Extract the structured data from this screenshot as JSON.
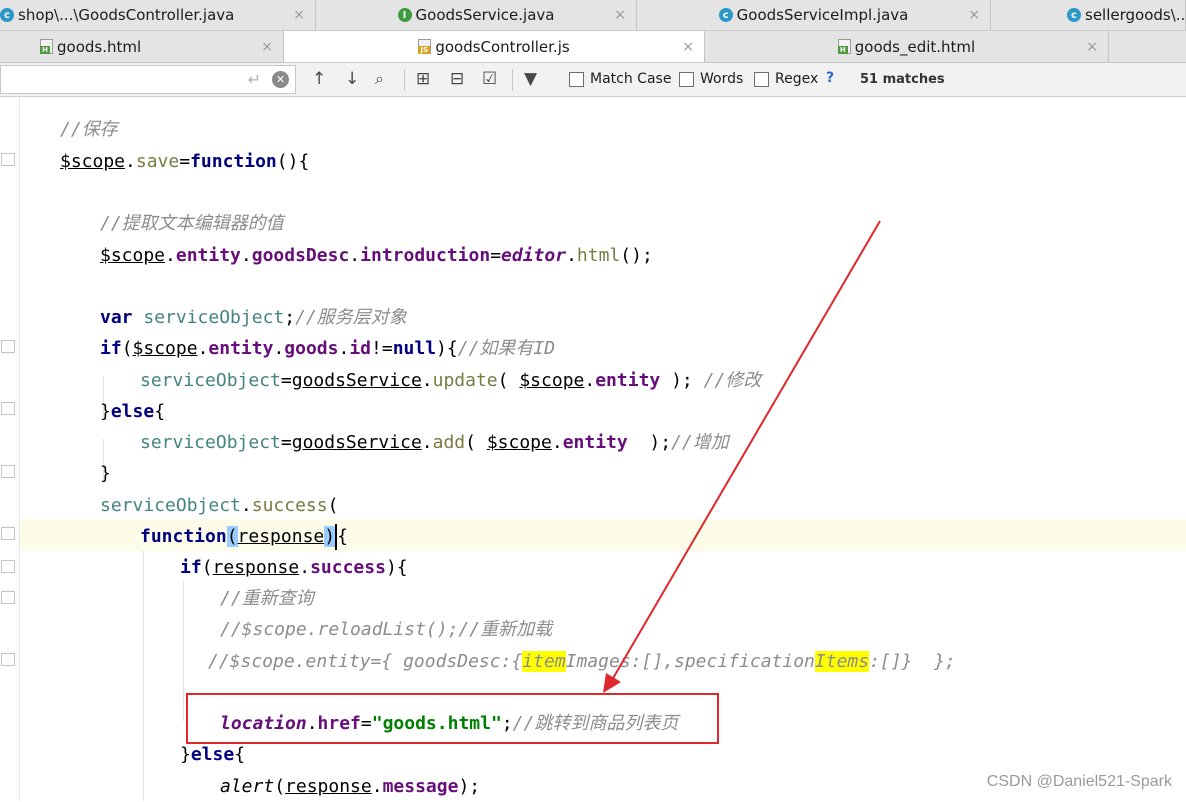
{
  "tabs_row1": [
    {
      "label": "shop\\...\\GoodsController.java",
      "icon": "java-class-icon"
    },
    {
      "label": "GoodsService.java",
      "icon": "java-interface-icon"
    },
    {
      "label": "GoodsServiceImpl.java",
      "icon": "java-class-icon"
    },
    {
      "label": "sellergoods\\...",
      "icon": "java-class-icon"
    }
  ],
  "tabs_row2": [
    {
      "label": "goods.html",
      "icon": "html-file-icon"
    },
    {
      "label": "goodsController.js",
      "icon": "js-file-icon",
      "active": true
    },
    {
      "label": "goods_edit.html",
      "icon": "html-file-icon"
    }
  ],
  "close_glyph": "×",
  "search": {
    "value": "",
    "match_case": "Match Case",
    "words": "Words",
    "regex": "Regex",
    "help": "?",
    "matches": "51 matches"
  },
  "code": [
    "//保存",
    "$scope.save=function(){",
    "//提取文本编辑器的值",
    "$scope.entity.goodsDesc.introduction=editor.html();",
    "var serviceObject;//服务层对象",
    "if($scope.entity.goods.id!=null){//如果有ID",
    "serviceObject=goodsService.update( $scope.entity ); //修改",
    "}else{",
    "serviceObject=goodsService.add( $scope.entity  );//增加",
    "}",
    "serviceObject.success(",
    "function(response){",
    "if(response.success){",
    "//重新查询",
    "//$scope.reloadList();//重新加载",
    "//$scope.entity={ goodsDesc:{itemImages:[],specificationItems:[]}  };",
    "location.href=\"goods.html\";//跳转到商品列表页",
    "}else{",
    "alert(response.message);"
  ],
  "watermark": "CSDN @Daniel521-Spark",
  "colors": {
    "annotation_red": "#e0282c",
    "search_highlight": "#ffff00",
    "keyword": "#000080",
    "string": "#008000",
    "comment": "#8c8c8c"
  }
}
